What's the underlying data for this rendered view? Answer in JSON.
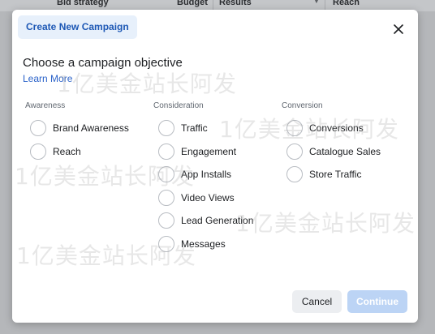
{
  "background_table": {
    "columns": [
      "Bid strategy",
      "Budget",
      "Results",
      "Reach"
    ]
  },
  "modal": {
    "tab_label": "Create New Campaign",
    "heading": "Choose a campaign objective",
    "learn_more": "Learn More",
    "columns": [
      {
        "label": "Awareness",
        "options": [
          "Brand Awareness",
          "Reach"
        ]
      },
      {
        "label": "Consideration",
        "options": [
          "Traffic",
          "Engagement",
          "App Installs",
          "Video Views",
          "Lead Generation",
          "Messages"
        ]
      },
      {
        "label": "Conversion",
        "options": [
          "Conversions",
          "Catalogue Sales",
          "Store Traffic"
        ]
      }
    ],
    "cancel_label": "Cancel",
    "continue_label": "Continue",
    "continue_disabled": true
  },
  "icons": {
    "close": "close-icon",
    "radio": "radio-unselected",
    "sort": "sort-caret-icon"
  },
  "colors": {
    "primary": "#1d58b5",
    "link": "#2a62c9",
    "tab_bg": "#e7f0fb",
    "continue_disabled_bg": "#bcd4f5",
    "cancel_bg": "#eceef1",
    "overlay": "#b5b7ba"
  },
  "watermark": {
    "text": "1亿美金站长阿发"
  }
}
